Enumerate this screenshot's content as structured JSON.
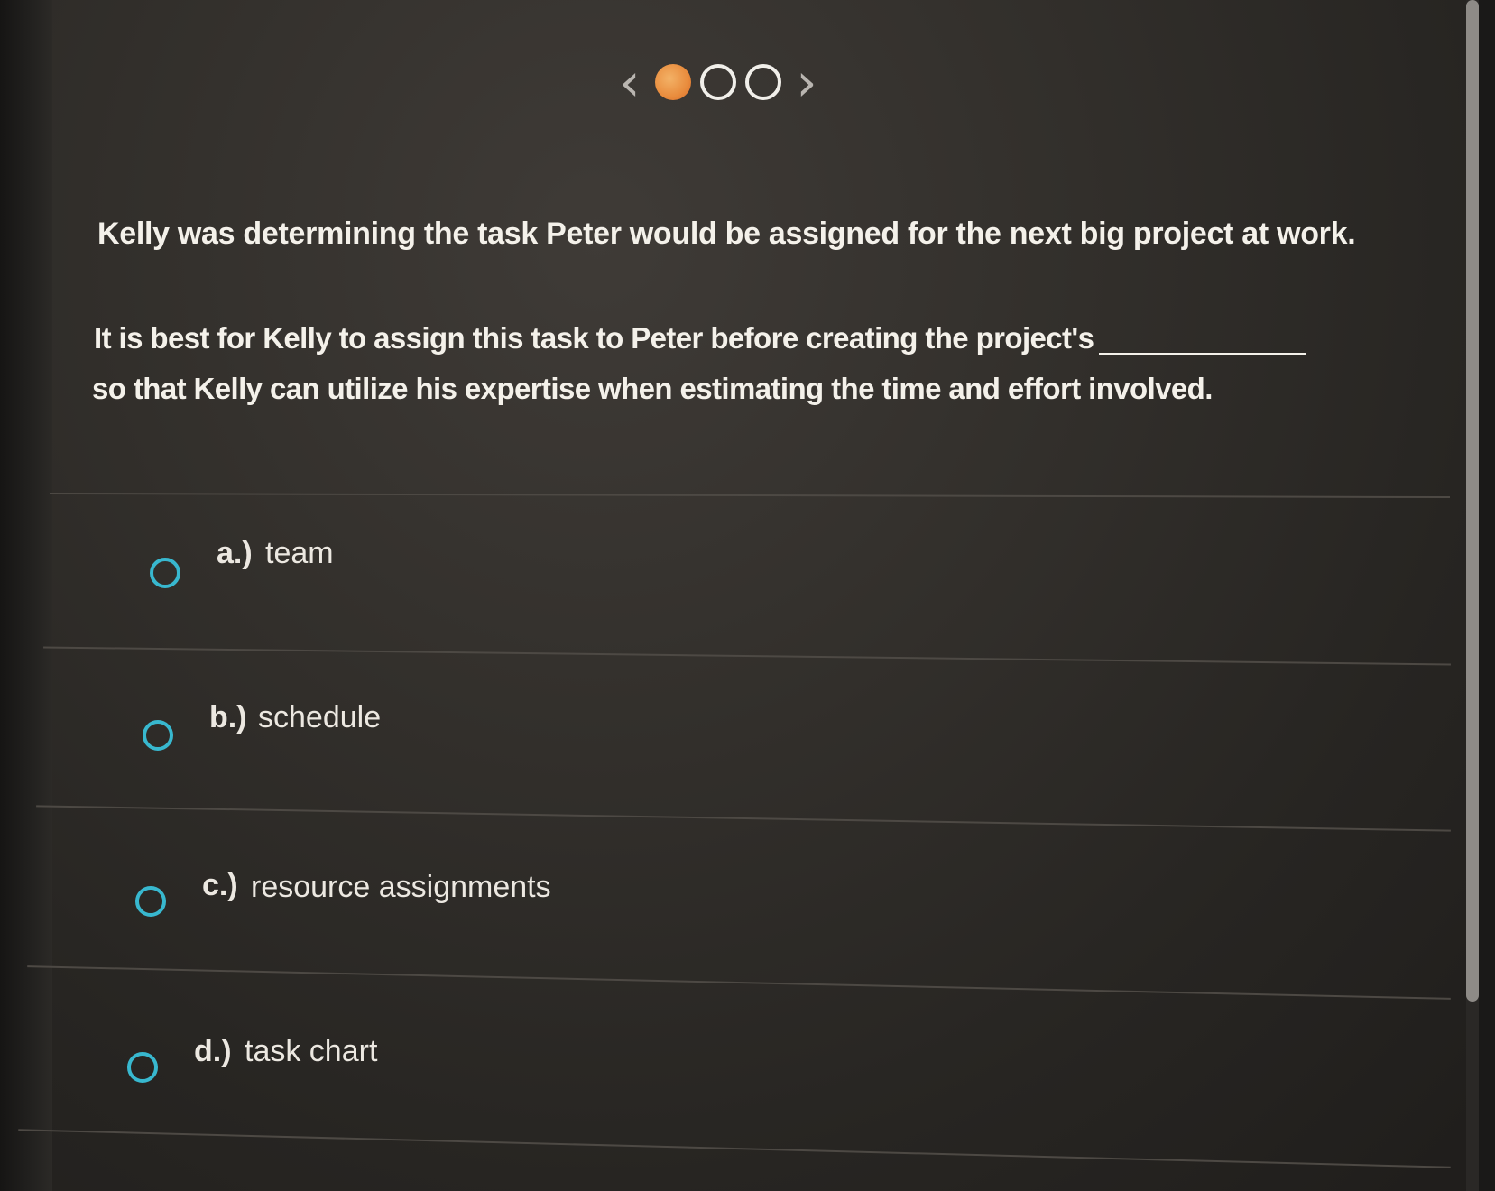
{
  "pager": {
    "prev_label": "‹",
    "next_label": "›",
    "dots": [
      {
        "state": "current",
        "color": "#e98c3d"
      },
      {
        "state": "unanswered",
        "color": "#f1efea"
      },
      {
        "state": "unanswered",
        "color": "#f1efea"
      }
    ]
  },
  "question": {
    "line1": "Kelly was determining the task Peter would be assigned for the next big project at work.",
    "line2": "It is best for Kelly to assign this task to Peter before creating the project's",
    "line3": "so that Kelly can utilize his expertise when estimating the time and effort involved."
  },
  "options": [
    {
      "letter": "a.)",
      "text": "team"
    },
    {
      "letter": "b.)",
      "text": "schedule"
    },
    {
      "letter": "c.)",
      "text": "resource assignments"
    },
    {
      "letter": "d.)",
      "text": "task chart"
    }
  ],
  "colors": {
    "radio": "#38b8cf",
    "text": "#f4f1ea",
    "background": "#33302c"
  }
}
